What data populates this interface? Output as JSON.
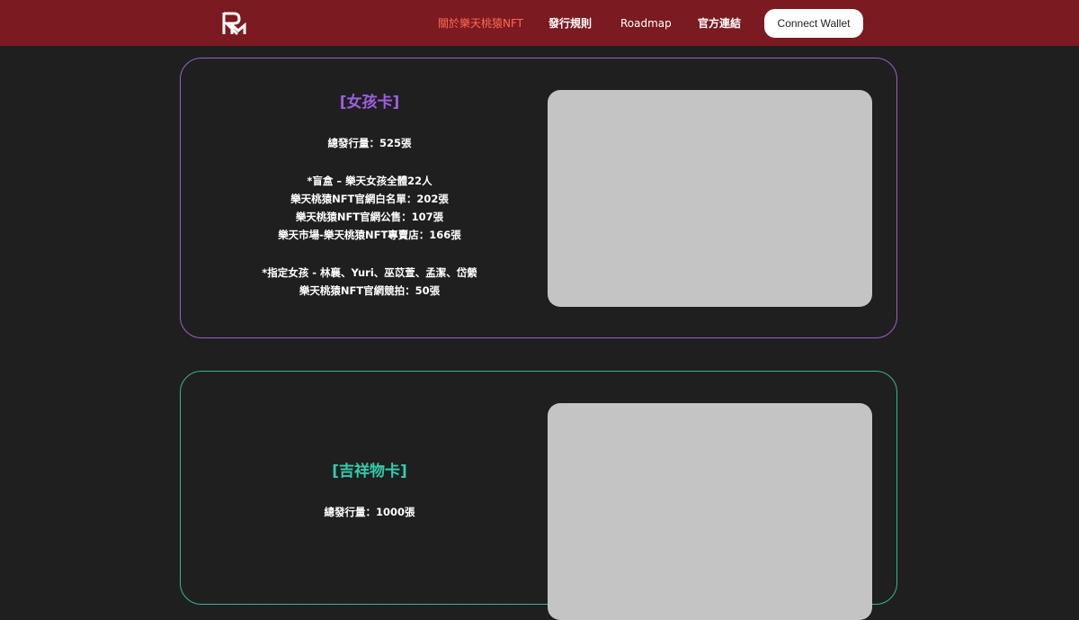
{
  "header": {
    "logo_icon": "rm-monogram-logo",
    "nav": [
      {
        "label": "關於樂天桃猿NFT"
      },
      {
        "label": "發行規則"
      },
      {
        "label": "Roadmap"
      },
      {
        "label": "官方連結"
      }
    ],
    "wallet_label": "Connect Wallet"
  },
  "cards": [
    {
      "title": "[女孩卡]",
      "accent": "#9e5fe0",
      "total": "總發行量：525張",
      "blind_box_heading": "*盲盒 – 樂天女孩全體22人",
      "blind_box_lines": [
        "樂天桃猿NFT官網白名單：202張",
        "樂天桃猿NFT官網公售：107張",
        "樂天市場-樂天桃猿NFT專賣店：166張"
      ],
      "designated_heading": "*指定女孩 - 林襄、Yuri、巫苡萱、孟潔、岱縈",
      "designated_lines": [
        "樂天桃猿NFT官網競拍：50張"
      ]
    },
    {
      "title": "[吉祥物卡]",
      "accent": "#33ccaa",
      "total": "總發行量：1000張"
    }
  ]
}
